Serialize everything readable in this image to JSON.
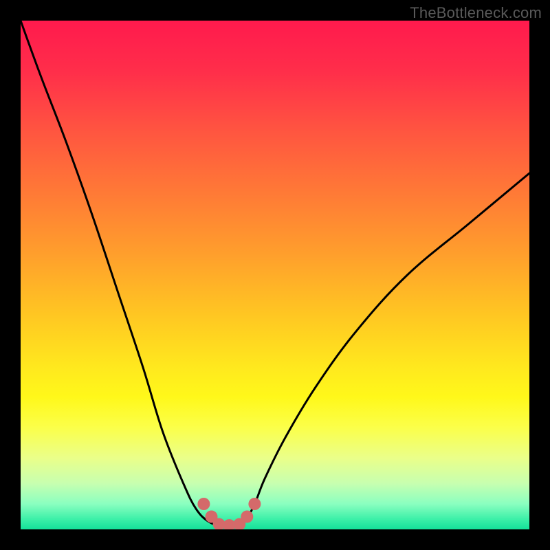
{
  "watermark": "TheBottleneck.com",
  "colors": {
    "frame": "#000000",
    "gradient_top": "#ff1a4d",
    "gradient_bottom": "#14e09a",
    "curve": "#000000",
    "marker": "#d46a6a"
  },
  "chart_data": {
    "type": "line",
    "title": "",
    "xlabel": "",
    "ylabel": "",
    "xlim": [
      0,
      100
    ],
    "ylim": [
      0,
      100
    ],
    "grid": false,
    "legend": false,
    "series": [
      {
        "name": "bottleneck-curve",
        "x": [
          0,
          4,
          9,
          14,
          19,
          24,
          28,
          32,
          34.5,
          37,
          40,
          42,
          44,
          46,
          48,
          52,
          58,
          66,
          76,
          88,
          100
        ],
        "y": [
          100,
          89,
          76,
          62,
          47,
          32,
          19,
          9,
          4,
          1.5,
          0.5,
          0.5,
          1.5,
          5,
          10,
          18,
          28,
          39,
          50,
          60,
          70
        ]
      }
    ],
    "markers": [
      {
        "name": "flat-bottom-left-end",
        "x": 36,
        "y": 5
      },
      {
        "name": "flat-bottom-left-mid",
        "x": 37.5,
        "y": 2.5
      },
      {
        "name": "flat-bottom-start",
        "x": 39,
        "y": 1
      },
      {
        "name": "flat-bottom-center",
        "x": 41,
        "y": 0.8
      },
      {
        "name": "flat-bottom-end",
        "x": 43,
        "y": 1
      },
      {
        "name": "flat-bottom-right-mid",
        "x": 44.5,
        "y": 2.5
      },
      {
        "name": "flat-bottom-right-end",
        "x": 46,
        "y": 5
      }
    ]
  }
}
